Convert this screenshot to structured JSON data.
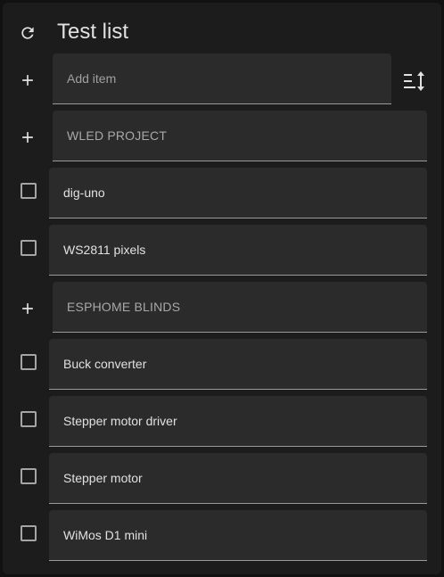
{
  "header": {
    "title": "Test list",
    "refresh_icon": "refresh-icon"
  },
  "add_item": {
    "placeholder": "Add item",
    "add_icon": "plus-icon",
    "sort_icon": "sort-icon"
  },
  "sections": [
    {
      "name": "WLED PROJECT",
      "items": [
        "dig-uno",
        "WS2811 pixels"
      ]
    },
    {
      "name": "ESPHOME BLINDS",
      "items": [
        "Buck converter",
        "Stepper motor driver",
        "Stepper motor",
        "WiMos D1 mini"
      ]
    }
  ],
  "colors": {
    "background": "#1c1c1c",
    "field": "#2b2b2b",
    "text": "#e1e1e1",
    "muted": "#a8a8a8"
  }
}
